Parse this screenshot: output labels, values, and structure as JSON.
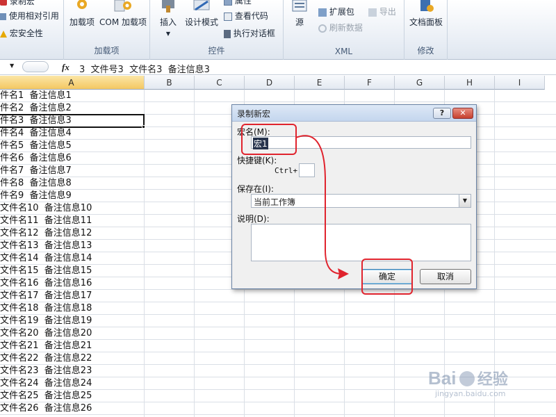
{
  "ribbon": {
    "groups": [
      {
        "label": "加载项"
      },
      {
        "label": "控件"
      },
      {
        "label": "XML"
      },
      {
        "label": "修改"
      }
    ],
    "code_items": [
      "录制宏",
      "使用相对引用",
      "宏安全性"
    ],
    "addins": [
      "加载项",
      "COM 加载项"
    ],
    "controls": {
      "insert": "插入",
      "design_mode": "设计模式",
      "properties": "属性",
      "view_code": "查看代码",
      "run_dialog": "执行对话框"
    },
    "xml": {
      "source": "源",
      "expansion": "扩展包",
      "refresh": "刷新数据",
      "export": "导出"
    },
    "modify": {
      "doc_panel": "文档面板"
    }
  },
  "formula_bar": {
    "fx": "fx",
    "content": "3  文件号3  文件名3  备注信息3"
  },
  "columns": [
    "A",
    "B",
    "C",
    "D",
    "E",
    "F",
    "G",
    "H",
    "I"
  ],
  "rows": [
    "件名1  备注信息1",
    "件名2  备注信息2",
    "件名3  备注信息3",
    "件名4  备注信息4",
    "件名5  备注信息5",
    "件名6  备注信息6",
    "件名7  备注信息7",
    "件名8  备注信息8",
    "件名9  备注信息9",
    "文件名10  备注信息10",
    "文件名11  备注信息11",
    "文件名12  备注信息12",
    "文件名13  备注信息13",
    "文件名14  备注信息14",
    "文件名15  备注信息15",
    "文件名16  备注信息16",
    "文件名17  备注信息17",
    "文件名18  备注信息18",
    "文件名19  备注信息19",
    "文件名20  备注信息20",
    "文件名21  备注信息21",
    "文件名22  备注信息22",
    "文件名23  备注信息23",
    "文件名24  备注信息24",
    "文件名25  备注信息25",
    "文件名26  备注信息26"
  ],
  "dialog": {
    "title": "录制新宏",
    "help": "?",
    "close": "✕",
    "macro_name_label": "宏名(M):",
    "macro_name_value": "宏1",
    "shortcut_label": "快捷键(K):",
    "ctrl_label": "Ctrl+",
    "shortcut_value": "",
    "store_label": "保存在(I):",
    "store_value": "当前工作簿",
    "desc_label": "说明(D):",
    "desc_value": "",
    "ok": "确定",
    "cancel": "取消"
  },
  "watermark": {
    "brand": "Bai",
    "brand2": "经验",
    "url": "jingyan.baidu.com"
  },
  "colors": {
    "annotation": "#e0232d",
    "selected_header": "#f4c862",
    "dialog_title": "#c4d6ee"
  }
}
